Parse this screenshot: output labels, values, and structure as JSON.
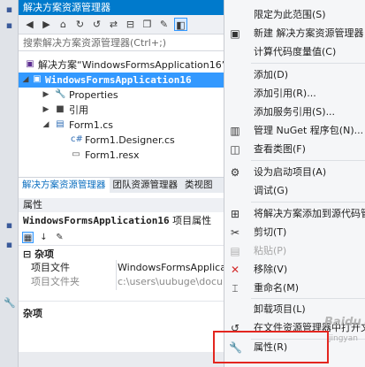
{
  "solution_explorer": {
    "title": "解决方案资源管理器",
    "search_placeholder": "搜索解决方案资源管理器(Ctrl+;)",
    "solution_label": "解决方案“WindowsFormsApplication16”",
    "project_label": "WindowsFormsApplication16",
    "tree": {
      "properties": "Properties",
      "references": "引用",
      "form1": "Form1.cs",
      "designer": "Form1.Designer.cs",
      "resx": "Form1.resx"
    },
    "tabs": [
      "解决方案资源管理器",
      "团队资源管理器",
      "类视图"
    ]
  },
  "properties_panel": {
    "title": "属性",
    "object_name": "WindowsFormsApplication16",
    "object_type": "项目属性",
    "category": "杂项",
    "rows": [
      {
        "key": "项目文件",
        "value": "WindowsFormsApplicati"
      },
      {
        "key": "项目文件夹",
        "value": "c:\\users\\uubuge\\docu"
      }
    ],
    "description_title": "杂项"
  },
  "context_menu": {
    "items": [
      {
        "label": "限定为此范围(S)",
        "icon": "none",
        "disabled": false
      },
      {
        "label": "新建 解决方案资源管理器",
        "icon": "new-window-icon",
        "disabled": false
      },
      {
        "label": "计算代码度量值(C)",
        "icon": "none",
        "disabled": false
      },
      {
        "label": "添加(D)",
        "icon": "none",
        "disabled": false
      },
      {
        "label": "添加引用(R)...",
        "icon": "none",
        "disabled": false
      },
      {
        "label": "添加服务引用(S)...",
        "icon": "none",
        "disabled": false
      },
      {
        "label": "管理 NuGet 程序包(N)...",
        "icon": "package-icon",
        "disabled": false
      },
      {
        "label": "查看类图(F)",
        "icon": "class-diagram-icon",
        "disabled": false
      },
      {
        "label": "设为启动项目(A)",
        "icon": "gear-icon",
        "disabled": false
      },
      {
        "label": "调试(G)",
        "icon": "none",
        "disabled": false
      },
      {
        "label": "将解决方案添加到源代码管",
        "icon": "source-control-icon",
        "disabled": false
      },
      {
        "label": "剪切(T)",
        "icon": "scissors-icon",
        "disabled": false
      },
      {
        "label": "粘贴(P)",
        "icon": "paste-icon",
        "disabled": true
      },
      {
        "label": "移除(V)",
        "icon": "remove-icon",
        "disabled": false
      },
      {
        "label": "重命名(M)",
        "icon": "rename-icon",
        "disabled": false
      },
      {
        "label": "卸载项目(L)",
        "icon": "none",
        "disabled": false
      },
      {
        "label": "在文件资源管理器中打开文",
        "icon": "refresh-icon",
        "disabled": false
      },
      {
        "label": "属性(R)",
        "icon": "wrench-icon",
        "disabled": false
      }
    ]
  },
  "watermark": {
    "main": "Baidu",
    "sub": "jingyan"
  },
  "colors": {
    "accent": "#007acc",
    "selection": "#3399ff",
    "highlight_box": "#e3261f"
  }
}
